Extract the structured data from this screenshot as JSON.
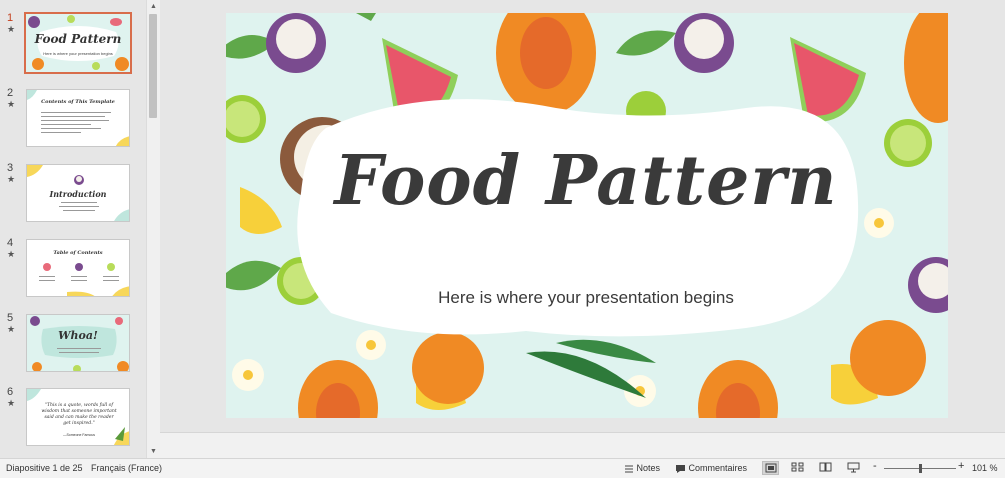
{
  "thumbnails": [
    {
      "number": "1",
      "star": "★",
      "title": "Food Pattern",
      "subtitle": "Here is where your presentation begins"
    },
    {
      "number": "2",
      "star": "★",
      "title": "Contents of This Template"
    },
    {
      "number": "3",
      "star": "★",
      "title": "Introduction"
    },
    {
      "number": "4",
      "star": "★",
      "title": "Table of Contents"
    },
    {
      "number": "5",
      "star": "★",
      "title": "Whoa!"
    },
    {
      "number": "6",
      "star": "★",
      "quote": "\"This is a quote, words full of wisdom that someone important said and can make the reader get inspired.\"",
      "author": "—Someone Famous"
    }
  ],
  "slide": {
    "title": "Food Pattern",
    "subtitle": "Here is where your presentation begins"
  },
  "statusbar": {
    "slide_info": "Diapositive 1 de 25",
    "language": "Français (France)",
    "notes_label": "Notes",
    "comments_label": "Commentaires",
    "zoom_minus": "-",
    "zoom_plus": "+",
    "zoom_level": "101 %",
    "zoom_fraction": 0.5
  },
  "icons": {
    "scroll_up": "▲",
    "scroll_down": "▼"
  },
  "colors": {
    "accent": "#c43e1c",
    "selection_border": "#d86d4b",
    "slide_background": "#dff3ef"
  }
}
